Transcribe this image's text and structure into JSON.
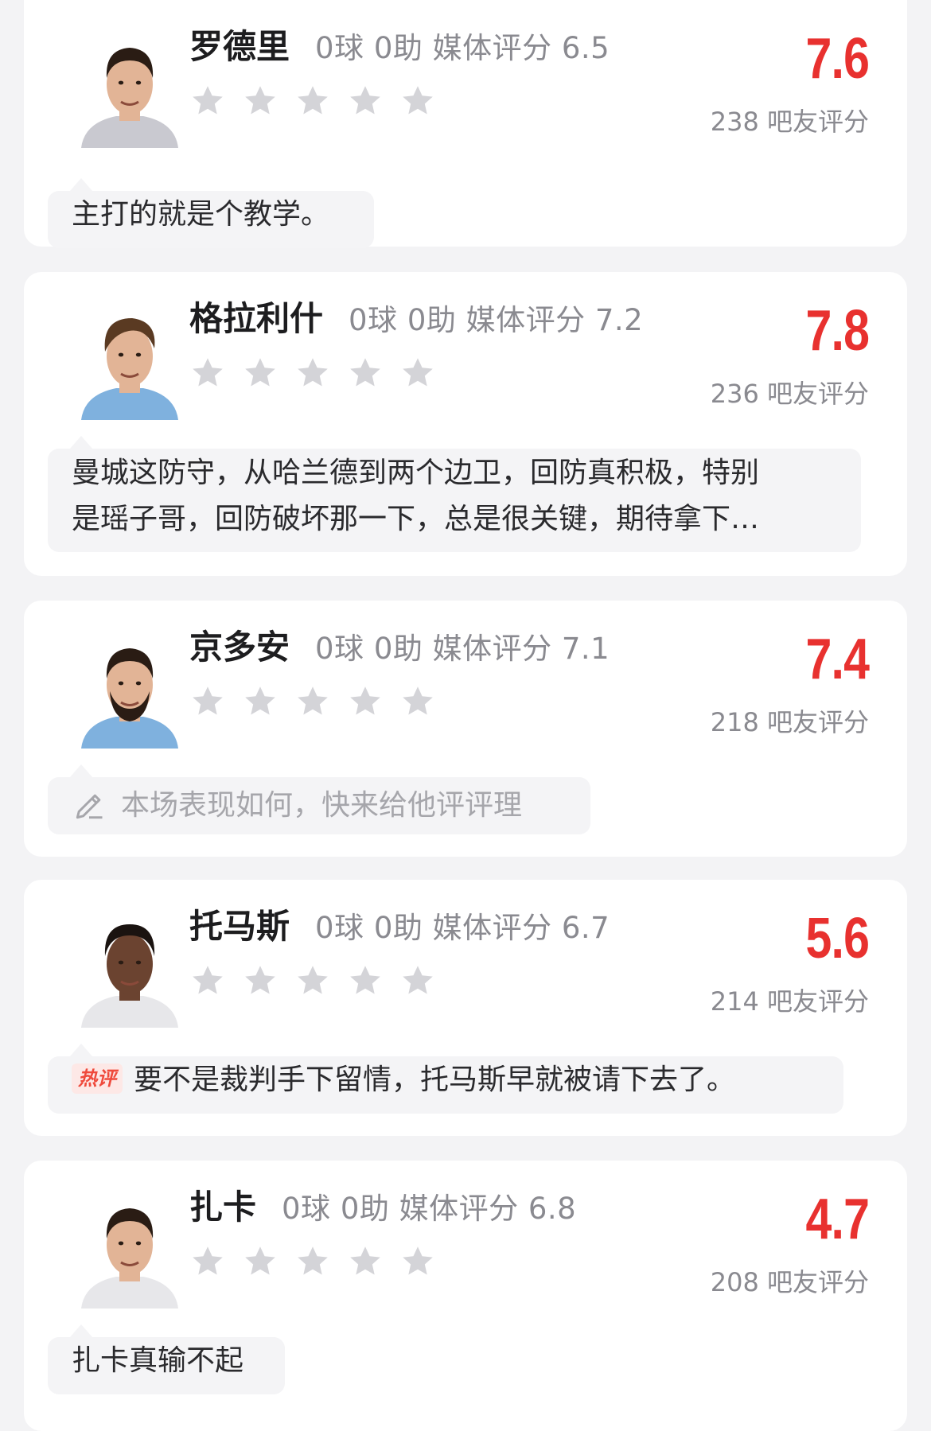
{
  "players": [
    {
      "name": "罗德里",
      "stats": "0球 0助  媒体评分 6.5",
      "score": "7.6",
      "rating_count": "238 吧友评分",
      "user_stars": 0,
      "comment_type": "text",
      "comment": "主打的就是个教学。",
      "shirt_color": "#c9c9d0",
      "hair": "dark-short"
    },
    {
      "name": "格拉利什",
      "stats": "0球 0助  媒体评分 7.2",
      "score": "7.8",
      "rating_count": "236 吧友评分",
      "user_stars": 0,
      "comment_type": "multiline",
      "comment_line1": "曼城这防守，从哈兰德到两个边卫，回防真积极，特别",
      "comment_line2": "是瑶子哥，回防破坏那一下，总是很关键，期待拿下…",
      "shirt_color": "#7fb1de",
      "hair": "brown-swept"
    },
    {
      "name": "京多安",
      "stats": "0球 0助  媒体评分 7.1",
      "score": "7.4",
      "rating_count": "218 吧友评分",
      "user_stars": 0,
      "comment_type": "prompt",
      "comment": "本场表现如何，快来给他评评理",
      "shirt_color": "#7fb1de",
      "hair": "dark-beard"
    },
    {
      "name": "托马斯",
      "stats": "0球 0助  媒体评分 6.7",
      "score": "5.6",
      "rating_count": "214 吧友评分",
      "user_stars": 0,
      "comment_type": "hot",
      "hot_badge": "热评",
      "comment": "要不是裁判手下留情，托马斯早就被请下去了。",
      "shirt_color": "#e7e7ea",
      "hair": "dark-curly"
    },
    {
      "name": "扎卡",
      "stats": "0球 0助  媒体评分 6.8",
      "score": "4.7",
      "rating_count": "208 吧友评分",
      "user_stars": 0,
      "comment_type": "text",
      "comment": "扎卡真输不起",
      "shirt_color": "#e7e7ea",
      "hair": "dark-short"
    }
  ],
  "colors": {
    "score": "#e8312f",
    "star_empty": "#d4d4d8",
    "bubble_bg": "#f4f4f6",
    "card_bg": "#ffffff",
    "page_bg": "#f3f3f5"
  },
  "icons": {
    "star": "star-icon",
    "prompt": "pencil-icon"
  }
}
